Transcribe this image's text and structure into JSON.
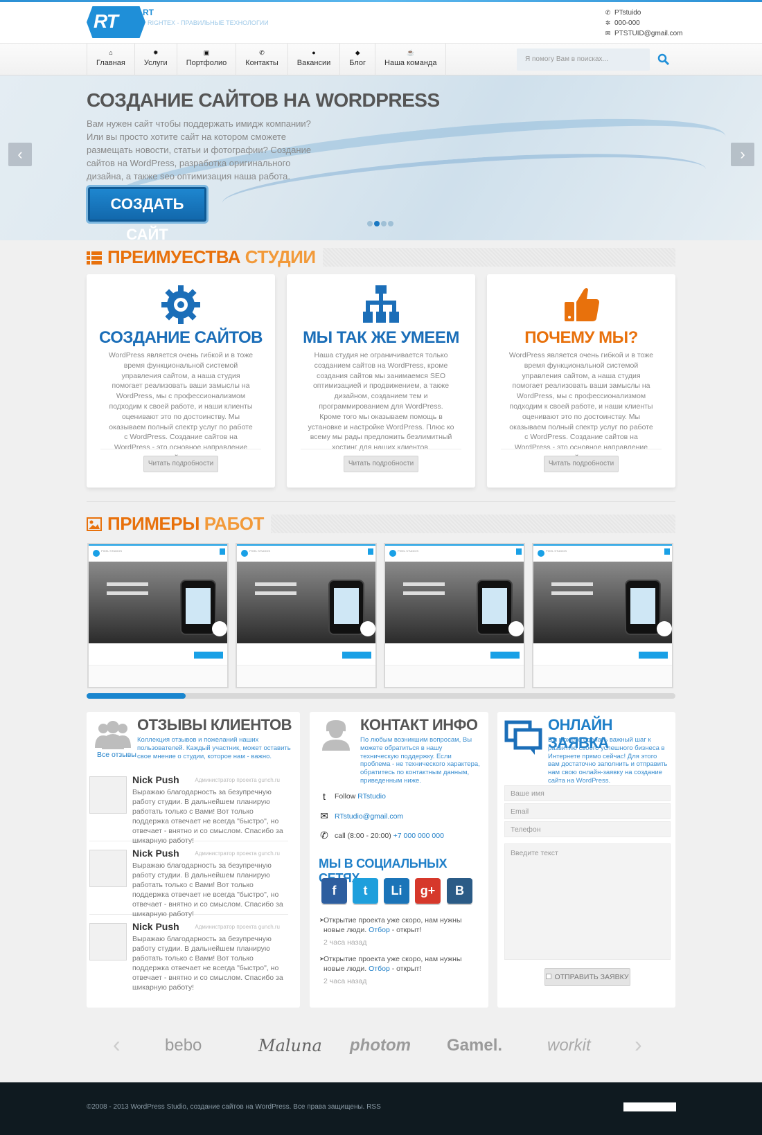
{
  "header": {
    "logo_text": "RT",
    "logo_sup": "RT",
    "tagline": "RIGHTEX - ПРАВИЛЬНЫЕ ТЕХНОЛОГИИ",
    "contacts": [
      {
        "icon": "skype-icon",
        "text": "PTstuido"
      },
      {
        "icon": "gear-icon",
        "text": "000-000"
      },
      {
        "icon": "mail-icon",
        "text": "PTSTUID@gmail.com"
      }
    ]
  },
  "nav": {
    "items": [
      {
        "icon": "home-icon",
        "label": "Главная"
      },
      {
        "icon": "cog-icon",
        "label": "Услуги"
      },
      {
        "icon": "portfolio-icon",
        "label": "Портфолио"
      },
      {
        "icon": "phone-icon",
        "label": "Контакты"
      },
      {
        "icon": "user-icon",
        "label": "Вакансии"
      },
      {
        "icon": "tag-icon",
        "label": "Блог"
      },
      {
        "icon": "team-icon",
        "label": "Наша команда"
      }
    ],
    "search_placeholder": "Я помогу Вам в поисках..."
  },
  "hero": {
    "title": "СОЗДАНИЕ САЙТОВ НА WORDPRESS",
    "text": "Вам нужен сайт чтобы поддержать имидж компании? Или вы просто хотите сайт на котором сможете размещать новости, статьи и фотографии? Создание сайтов на WordPress, разработка оригинального дизайна, а также seo оптимизация наша работа.",
    "button": "СОЗДАТЬ САЙТ",
    "prev": "‹",
    "next": "›",
    "slides": 4,
    "active_slide": 2
  },
  "advantages": {
    "title_a": "ПРЕИМУЕСТВА",
    "title_b": " СТУДИИ",
    "cards": [
      {
        "icon": "gear-icon",
        "title": "СОЗДАНИЕ САЙТОВ",
        "color": "#1b6eb8",
        "text": "WordPress является очень гибкой и в тоже время функциональной системой управления сайтом, а наша студия помогает реализовать ваши замыслы на WordPress, мы с профессионализмом подходим к своей работе, и наши клиенты оценивают это по достоинству. Мы оказываем полный спектр услуг по работе с WordPress. Создание сайтов на WordPress - это основное направление нашей студии.",
        "button": "Читать подробности"
      },
      {
        "icon": "sitemap-icon",
        "title": "МЫ ТАК ЖЕ УМЕЕМ",
        "color": "#1b6eb8",
        "text": "Наша студия не ограничивается только созданием сайтов на WordPress, кроме создания сайтов мы занимаемся SEO оптимизацией и продвижением, а также дизайном, созданием тем и программированием для WordPress. Кроме того мы оказываем помощь в установке и настройке WordPress. Плюс ко всему мы рады предложить безлимитный хостинг для наших клиентов.",
        "button": "Читать подробности"
      },
      {
        "icon": "thumbs-up-icon",
        "title": "ПОЧЕМУ МЫ?",
        "color": "#e8710c",
        "text": "WordPress является очень гибкой и в тоже время функциональной системой управления сайтом, а наша студия помогает реализовать ваши замыслы на WordPress, мы с профессионализмом подходим к своей работе, и наши клиенты оценивают это по достоинству. Мы оказываем полный спектр услуг по работе с WordPress. Создание сайтов на WordPress - это основное направление нашей студии.",
        "button": "Читать подробности"
      }
    ]
  },
  "works": {
    "title_a": "ПРИМЕРЫ",
    "title_b": " РАБОТ",
    "items": [
      {
        "brand": "PIXEL STUDIOS",
        "headline": "WELCOME TO PIXEL STUDIOS"
      },
      {
        "brand": "PIXEL STUDIOS",
        "headline": "WELCOME TO PIXEL STUDIOS"
      },
      {
        "brand": "PIXEL STUDIOS",
        "headline": "WELCOME TO PIXEL STUDIOS"
      },
      {
        "brand": "PIXEL STUDIOS",
        "headline": "WELCOME TO PIXEL STUDIOS"
      }
    ],
    "scroll_position": 0.17
  },
  "reviews": {
    "title": "ОТЗЫВЫ КЛИЕНТОВ",
    "desc": "Коллекция отзывов и пожеланий наших пользователей. Каждый участник, может оставить свое мнение о студии, которое нам - важно.",
    "all_link": "Все отзывы",
    "items": [
      {
        "name": "Nick Push",
        "role": "Администратор проекта gunch.ru",
        "text": "Выражаю благодарность за безупречную работу студии. В дальнейшем планирую работать только с Вами! Вот только поддержка отвечает не всегда \"быстро\", но отвечает - внятно и со смыслом. Спасибо за шикарную работу!"
      },
      {
        "name": "Nick Push",
        "role": "Администратор проекта gunch.ru",
        "text": "Выражаю благодарность за безупречную работу студии. В дальнейшем планирую работать только с Вами! Вот только поддержка отвечает не всегда \"быстро\", но отвечает - внятно и со смыслом. Спасибо за шикарную работу!"
      },
      {
        "name": "Nick Push",
        "role": "Администратор проекта gunch.ru",
        "text": "Выражаю благодарность за безупречную работу студии. В дальнейшем планирую работать только с Вами! Вот только поддержка отвечает не всегда \"быстро\", но отвечает - внятно и со смыслом. Спасибо за шикарную работу!"
      }
    ]
  },
  "contact": {
    "title": "КОНТАКТ ИНФО",
    "desc": "По любым возникшим вопросам, Вы можете обратиться в нашу техническую поддержку. Если проблема - не технического характера, обратитесь по контактным данным, приведенным ниже.",
    "follow_prefix": "Follow ",
    "follow_link": "RTstudio",
    "email": "RTstudio@gmail.com",
    "call_prefix": "call (8:00 - 20:00) ",
    "phone": "+7 000 000 000",
    "social_title": "МЫ В СОЦИАЛЬНЫХ СЕТЯХ",
    "social": [
      {
        "name": "facebook-button",
        "label": "f",
        "color": "#2d5e9f"
      },
      {
        "name": "twitter-button",
        "label": "t",
        "color": "#1e9fdc"
      },
      {
        "name": "linkedin-button",
        "label": "Li",
        "color": "#1b74b8"
      },
      {
        "name": "googleplus-button",
        "label": "g+",
        "color": "#d6382b"
      },
      {
        "name": "vk-button",
        "label": "B",
        "color": "#2b5b86"
      }
    ],
    "tweets": [
      {
        "pre": "Открытие проекта уже скоро, нам нужны новые люди. ",
        "link": "Отбор",
        "post": " - открыт!",
        "ago": "2 часа назад"
      },
      {
        "pre": "Открытие проекта уже скоро, нам нужны новые люди. ",
        "link": "Отбор",
        "post": " - открыт!",
        "ago": "2 часа назад"
      }
    ]
  },
  "order": {
    "title": "ОНЛАЙН ЗАЯВКА",
    "desc": "Вы можете сделать важный шаг к развитию своего успешного бизнеса в Интернете прямо сейчас! Для этого вам достаточно заполнить и отправить нам свою онлайн-заявку на создание сайта на WordPress.",
    "name_ph": "Ваше имя",
    "email_ph": "Email",
    "phone_ph": "Телефон",
    "text_ph": "Введите текст",
    "submit": "ОТПРАВИТЬ ЗАЯВКУ"
  },
  "brands": {
    "prev": "‹",
    "next": "›",
    "items": [
      "bebo",
      "Maluna",
      "photom",
      "Gamel.",
      "workit"
    ]
  },
  "footer": {
    "text": "©2008 - 2013 WordPress Studio, создание сайтов на WordPress. Все права защищены. RSS"
  }
}
